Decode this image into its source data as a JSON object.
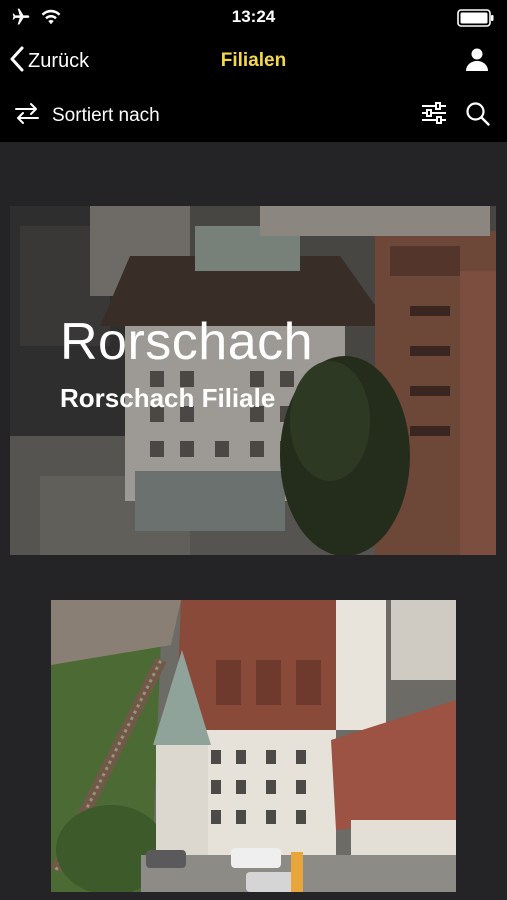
{
  "status_bar": {
    "time": "13:24",
    "icons": [
      "airplane-icon",
      "wifi-icon",
      "battery-icon"
    ]
  },
  "nav": {
    "back_label": "Zurück",
    "title": "Filialen",
    "title_color": "#f5d949"
  },
  "toolbar": {
    "sort_label": "Sortiert nach",
    "icons": [
      "sort-arrows-icon",
      "filter-sliders-icon",
      "search-icon"
    ]
  },
  "cards": [
    {
      "title": "Rorschach",
      "subtitle": "Rorschach Filiale"
    },
    {
      "title": "",
      "subtitle": ""
    }
  ],
  "colors": {
    "background": "#242427",
    "bars": "#000000",
    "accent": "#f5d949"
  }
}
